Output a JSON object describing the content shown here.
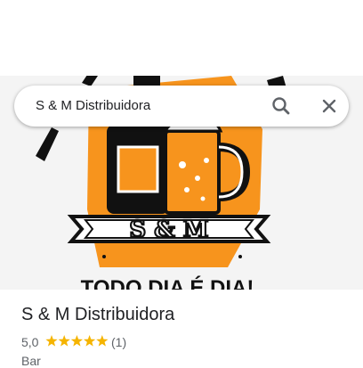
{
  "search": {
    "query": "S & M Distribuidora",
    "search_icon": "search-icon",
    "close_icon": "close-icon"
  },
  "place": {
    "name": "S & M Distribuidora",
    "rating": "5,0",
    "rating_stars": 5,
    "review_count": "(1)",
    "category": "Bar"
  },
  "logo": {
    "banner_text": "S & M",
    "slogan": "TODO DIA É DIA!"
  },
  "colors": {
    "star": "#f5b400",
    "logo_orange": "#f7941d",
    "text": "#202124",
    "muted": "#5f6368"
  }
}
